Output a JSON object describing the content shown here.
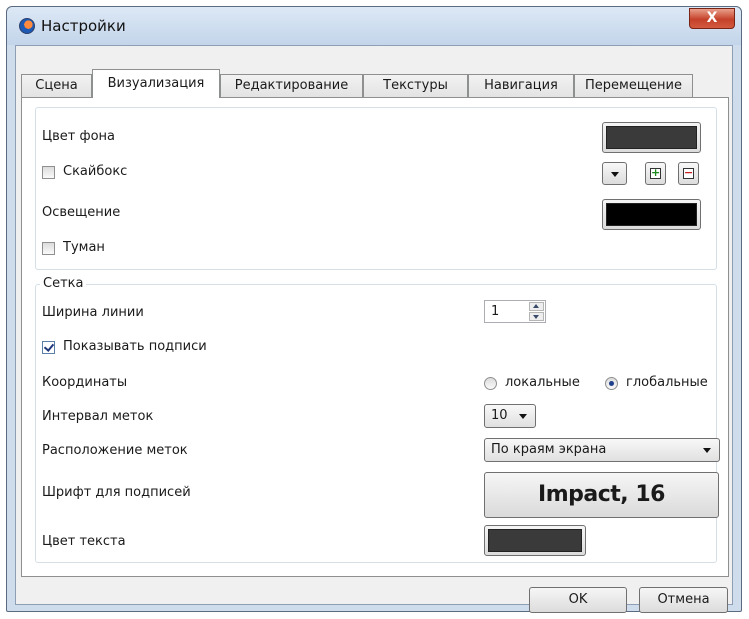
{
  "window": {
    "title": "Настройки",
    "close_glyph": "X"
  },
  "tabs": [
    {
      "label": "Сцена",
      "active": false
    },
    {
      "label": "Визуализация",
      "active": true
    },
    {
      "label": "Редактирование",
      "active": false
    },
    {
      "label": "Текстуры",
      "active": false
    },
    {
      "label": "Навигация",
      "active": false
    },
    {
      "label": "Перемещение",
      "active": false
    }
  ],
  "visual": {
    "bg_color_label": "Цвет фона",
    "bg_color_value": "#3a3a3a",
    "skybox_label": "Скайбокс",
    "skybox_checked": false,
    "lighting_label": "Освещение",
    "lighting_color_value": "#000000",
    "fog_label": "Туман",
    "fog_checked": false
  },
  "grid": {
    "group_title": "Сетка",
    "line_width_label": "Ширина линии",
    "line_width_value": "1",
    "show_labels_label": "Показывать подписи",
    "show_labels_checked": true,
    "coords_label": "Координаты",
    "coords_options": [
      "локальные",
      "глобальные"
    ],
    "coords_selected": "глобальные",
    "tick_interval_label": "Интервал меток",
    "tick_interval_value": "10",
    "tick_position_label": "Расположение меток",
    "tick_position_value": "По краям экрана",
    "font_label": "Шрифт для подписей",
    "font_value": "Impact, 16",
    "text_color_label": "Цвет текста",
    "text_color_value": "#3a3a3a"
  },
  "footer": {
    "ok_label": "OK",
    "cancel_label": "Отмена"
  },
  "colors": {
    "titlebar": "#c3d5ea",
    "close_button": "#c5412a",
    "checkbox_mark": "#20377a"
  }
}
